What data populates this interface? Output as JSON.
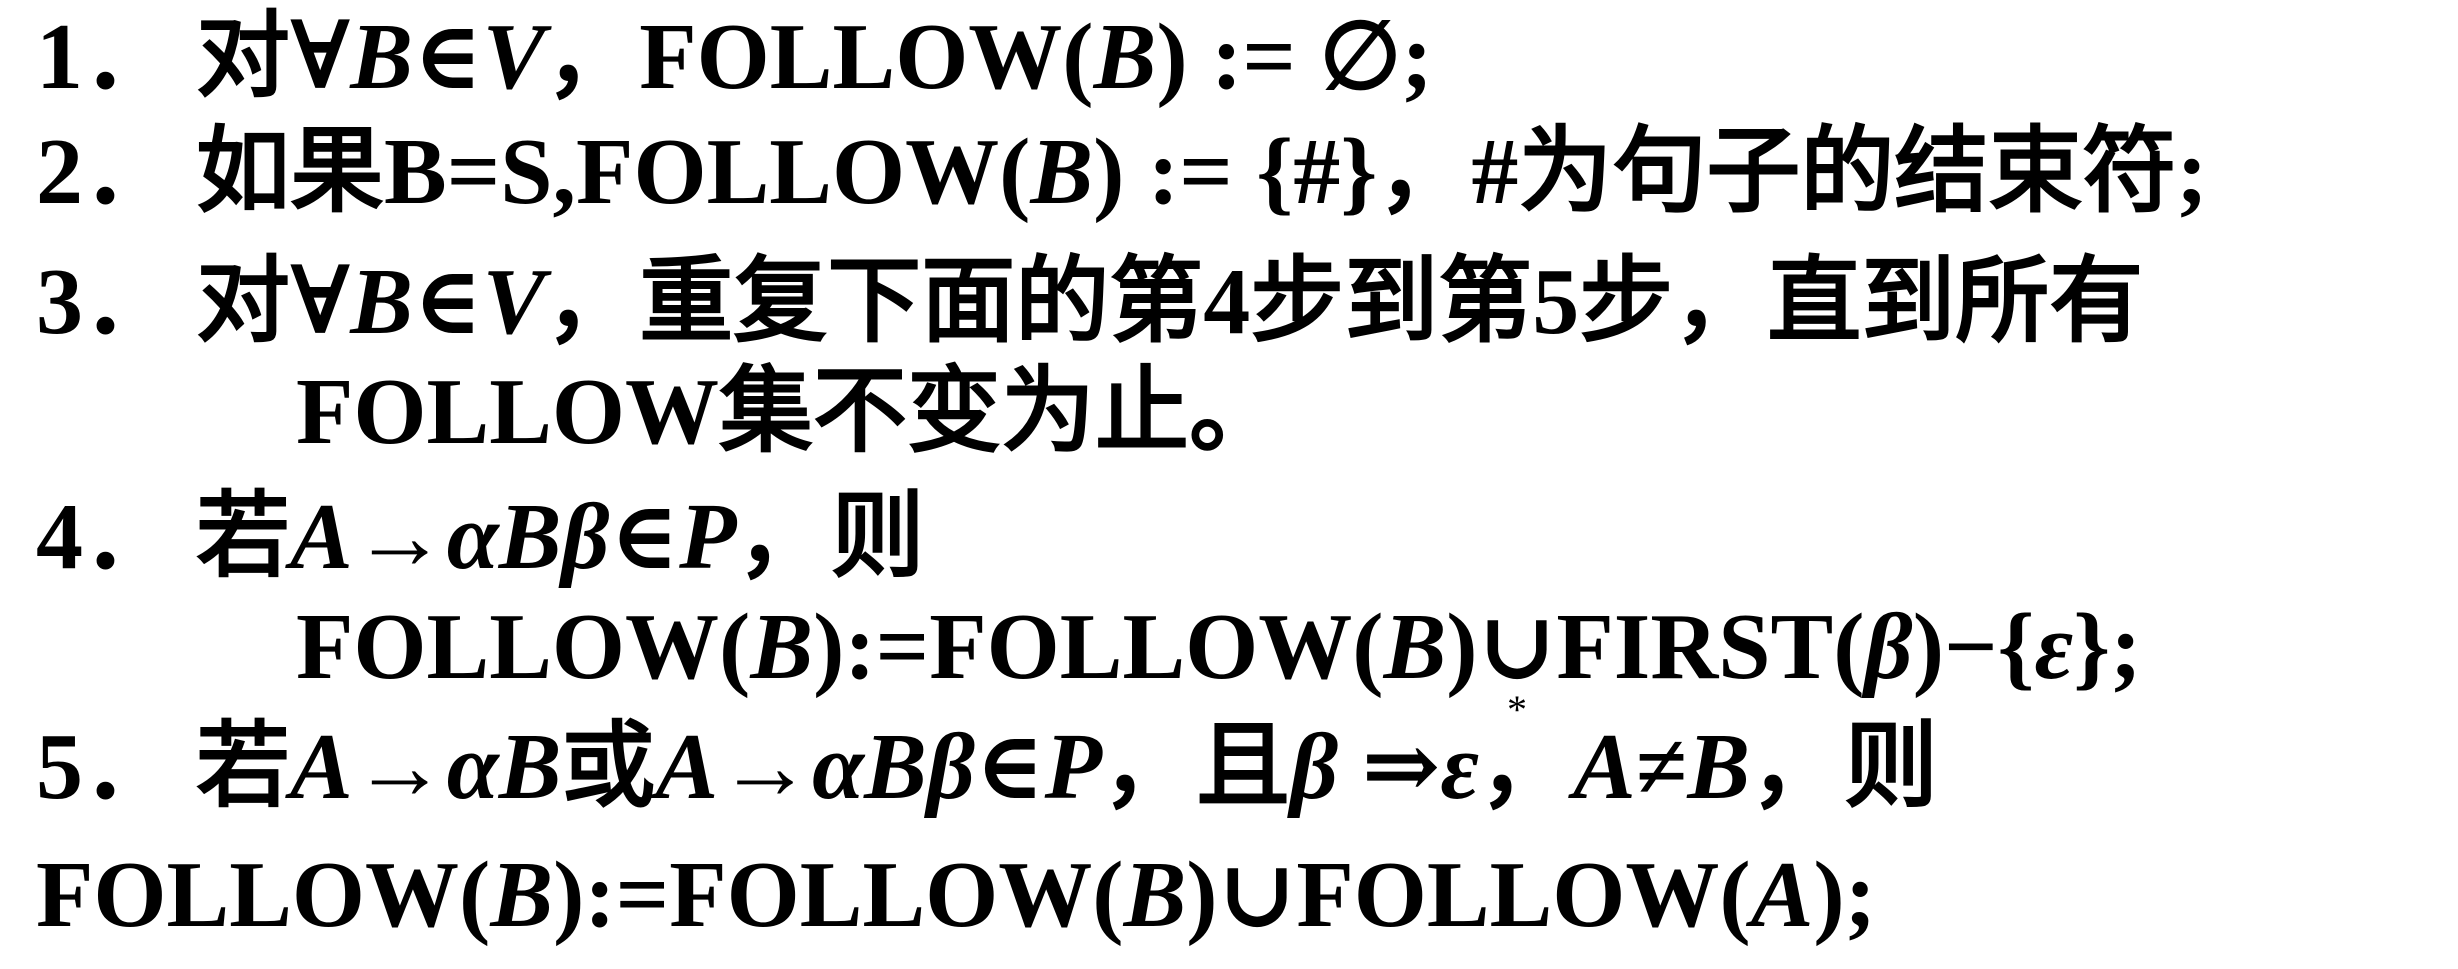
{
  "document": {
    "lines": [
      {
        "number": "1．",
        "segments": [
          {
            "text": "对∀",
            "italic": false
          },
          {
            "text": "B",
            "italic": true
          },
          {
            "text": "∈",
            "italic": false
          },
          {
            "text": "V",
            "italic": true
          },
          {
            "text": "，FOLLOW(",
            "italic": false
          },
          {
            "text": "B",
            "italic": true
          },
          {
            "text": ") := ∅;",
            "italic": false
          }
        ]
      },
      {
        "number": "2．",
        "segments": [
          {
            "text": "如果B=S,FOLLOW(",
            "italic": false
          },
          {
            "text": "B",
            "italic": true
          },
          {
            "text": ") := {#}，#为句子的结束符;",
            "italic": false
          }
        ]
      },
      {
        "number": "3．",
        "segments": [
          {
            "text": "对∀",
            "italic": false
          },
          {
            "text": "B",
            "italic": true
          },
          {
            "text": "∈",
            "italic": false
          },
          {
            "text": "V",
            "italic": true
          },
          {
            "text": "，重复下面的第4步到第5步，直到所有",
            "italic": false
          }
        ]
      },
      {
        "number": "",
        "segments": [
          {
            "text": "FOLLOW集不变为止。",
            "italic": false
          }
        ]
      },
      {
        "number": "4．",
        "segments": [
          {
            "text": "若",
            "italic": false
          },
          {
            "text": "A",
            "italic": true
          },
          {
            "text": "→",
            "italic": false
          },
          {
            "text": "αBβ",
            "italic": true
          },
          {
            "text": "∈",
            "italic": false
          },
          {
            "text": "P",
            "italic": true
          },
          {
            "text": "，则",
            "italic": false
          }
        ]
      },
      {
        "number": "",
        "segments": [
          {
            "text": "FOLLOW(",
            "italic": false
          },
          {
            "text": "B",
            "italic": true
          },
          {
            "text": "):=FOLLOW(",
            "italic": false
          },
          {
            "text": "B",
            "italic": true
          },
          {
            "text": ")∪FIRST(",
            "italic": false
          },
          {
            "text": "β",
            "italic": true
          },
          {
            "text": ")−{",
            "italic": false
          },
          {
            "text": "ε",
            "italic": true
          },
          {
            "text": "};",
            "italic": false
          }
        ]
      },
      {
        "number": "5．",
        "segments": [
          {
            "text": "若",
            "italic": false
          },
          {
            "text": "A",
            "italic": true
          },
          {
            "text": "→",
            "italic": false
          },
          {
            "text": "αB",
            "italic": true
          },
          {
            "text": "或",
            "italic": false
          },
          {
            "text": "A",
            "italic": true
          },
          {
            "text": "→",
            "italic": false
          },
          {
            "text": "αBβ",
            "italic": true
          },
          {
            "text": "∈",
            "italic": false
          },
          {
            "text": "P",
            "italic": true
          },
          {
            "text": "，且",
            "italic": false
          },
          {
            "text": "β",
            "italic": true
          },
          {
            "text": " ⇒",
            "italic": false
          },
          {
            "text": "ε",
            "italic": true
          },
          {
            "text": "，",
            "italic": false
          },
          {
            "text": "A",
            "italic": true
          },
          {
            "text": "≠",
            "italic": false
          },
          {
            "text": "B",
            "italic": true
          },
          {
            "text": "，则",
            "italic": false
          }
        ]
      },
      {
        "number": "",
        "segments": [
          {
            "text": "FOLLOW(",
            "italic": false
          },
          {
            "text": "B",
            "italic": true
          },
          {
            "text": "):=FOLLOW(",
            "italic": false
          },
          {
            "text": "B",
            "italic": true
          },
          {
            "text": ")∪FOLLOW(",
            "italic": false
          },
          {
            "text": "A",
            "italic": true
          },
          {
            "text": ");",
            "italic": false
          }
        ]
      }
    ],
    "derivation_star": "*"
  }
}
